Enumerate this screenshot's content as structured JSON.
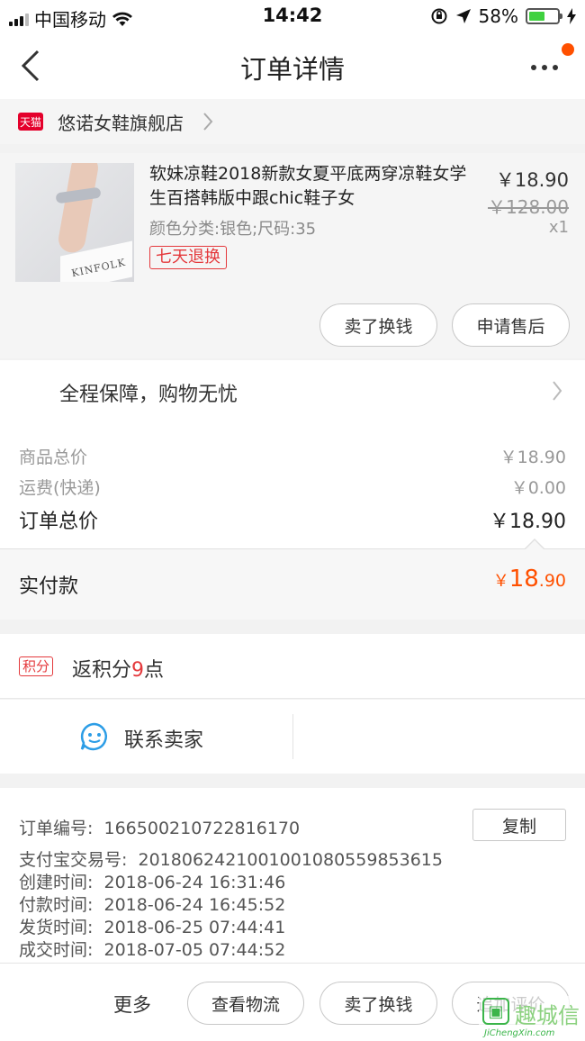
{
  "status_bar": {
    "carrier": "中国移动",
    "time": "14:42",
    "battery_pct": "58%",
    "battery_level": 0.58,
    "battery_color": "#3fd13f"
  },
  "nav": {
    "title": "订单详情",
    "back_icon": "chevron-left-icon",
    "more_icon": "more-dots-icon",
    "badge_color": "#ff5000"
  },
  "store": {
    "badge": "天猫",
    "name": "悠诺女鞋旗舰店"
  },
  "product": {
    "title": "软妹凉鞋2018新款女夏平底两穿凉鞋女学生百搭韩版中跟chic鞋子女",
    "sku": "颜色分类:银色;尺码:35",
    "tag": "七天退换",
    "price": "￥18.90",
    "original_price": "￥128.00",
    "quantity": "x1",
    "box_text": "KINFOLK",
    "buttons": [
      "卖了换钱",
      "申请售后"
    ]
  },
  "guarantee": {
    "text": "全程保障，购物无忧"
  },
  "totals": {
    "goods_label": "商品总价",
    "goods_value": "￥18.90",
    "shipping_label": "运费(快递)",
    "shipping_value": "￥0.00",
    "order_total_label": "订单总价",
    "order_total_value": "￥18.90",
    "paid_label": "实付款",
    "paid_currency": "￥",
    "paid_int": "18",
    "paid_dec": ".90",
    "accent_color": "#ff5000"
  },
  "points": {
    "badge": "积分",
    "prefix": "返积分",
    "count": "9",
    "suffix": "点"
  },
  "contact": {
    "label": "联系卖家",
    "icon": "chat-smile-icon"
  },
  "order_info": {
    "copy_label": "复制",
    "lines": [
      {
        "label": "订单编号:",
        "value": "166500210722816170"
      },
      {
        "label": "支付宝交易号:",
        "value": "2018062421001001080559853615"
      },
      {
        "label": "创建时间:",
        "value": "2018-06-24 16:31:46"
      },
      {
        "label": "付款时间:",
        "value": "2018-06-24 16:45:52"
      },
      {
        "label": "发货时间:",
        "value": "2018-06-25 07:44:41"
      },
      {
        "label": "成交时间:",
        "value": "2018-07-05 07:44:52"
      }
    ]
  },
  "footer": {
    "more": "更多",
    "buttons": [
      "查看物流",
      "卖了换钱",
      "追加评价"
    ]
  },
  "watermark": {
    "cn": "趣城信",
    "en": "JiChengXin.com"
  }
}
